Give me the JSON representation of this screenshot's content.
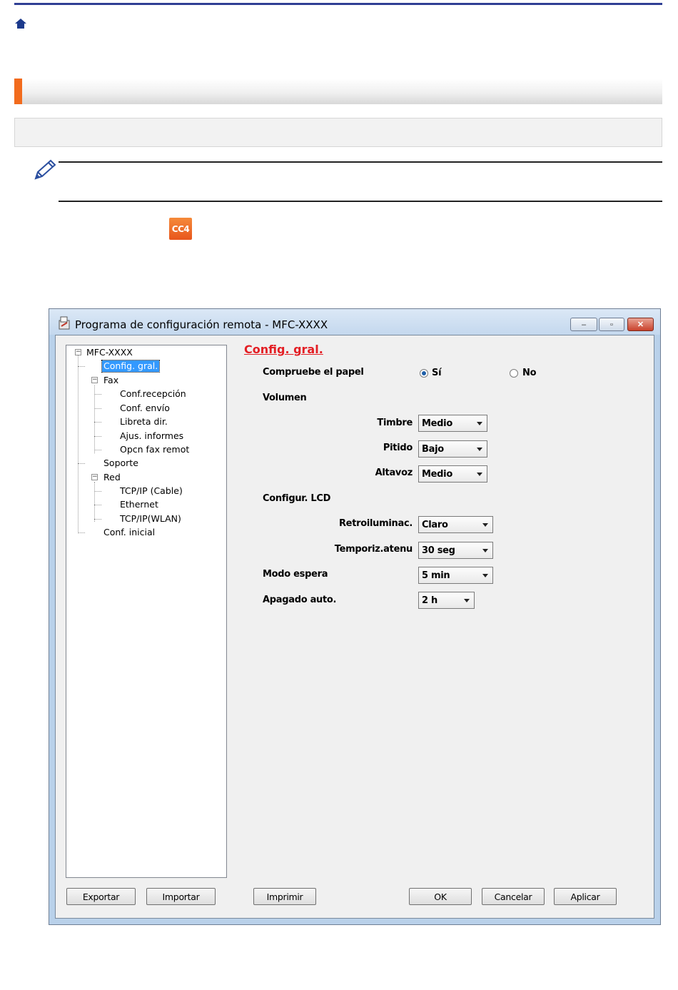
{
  "window": {
    "title": "Programa de configuración remota - MFC-XXXX",
    "min_glyph": "–",
    "max_glyph": "▫",
    "close_glyph": "✕"
  },
  "page_icons": {
    "cc4_label": "CC4"
  },
  "tree": {
    "root": "MFC-XXXX",
    "items": [
      {
        "label": "Config. gral.",
        "selected": true
      },
      {
        "label": "Fax"
      },
      {
        "label": "Conf.recepción"
      },
      {
        "label": "Conf. envío"
      },
      {
        "label": "Libreta dir."
      },
      {
        "label": "Ajus. informes"
      },
      {
        "label": "Opcn fax remot"
      },
      {
        "label": "Soporte"
      },
      {
        "label": "Red"
      },
      {
        "label": "TCP/IP (Cable)"
      },
      {
        "label": "Ethernet"
      },
      {
        "label": "TCP/IP(WLAN)"
      },
      {
        "label": "Conf. inicial"
      }
    ]
  },
  "panel": {
    "title": "Config. gral.",
    "check_paper": {
      "label": "Compruebe el papel",
      "opt_yes": "Sí",
      "opt_no": "No",
      "selected": "Sí"
    },
    "volume": {
      "label": "Volumen",
      "ring": {
        "label": "Timbre",
        "value": "Medio"
      },
      "beep": {
        "label": "Pitido",
        "value": "Bajo"
      },
      "speaker": {
        "label": "Altavoz",
        "value": "Medio"
      }
    },
    "lcd": {
      "label": "Configur. LCD",
      "backlight": {
        "label": "Retroiluminac.",
        "value": "Claro"
      },
      "dim_timer": {
        "label": "Temporiz.atenu",
        "value": "30 seg"
      }
    },
    "sleep": {
      "label": "Modo espera",
      "value": "5 min"
    },
    "auto_off": {
      "label": "Apagado auto.",
      "value": "2 h"
    }
  },
  "buttons": {
    "export": "Exportar",
    "import": "Importar",
    "print": "Imprimir",
    "ok": "OK",
    "cancel": "Cancelar",
    "apply": "Aplicar"
  },
  "colors": {
    "accent": "#f26b1d",
    "link_red": "#e31e24",
    "topline": "#2f3f94"
  }
}
